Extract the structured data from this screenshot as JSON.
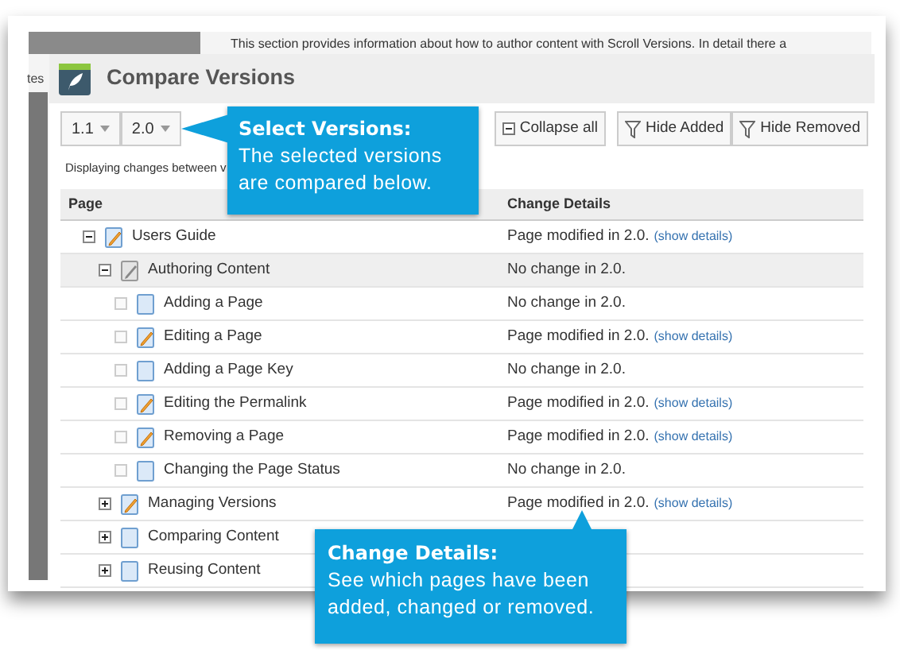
{
  "background_page": {
    "text": "This section provides information about how to author content with Scroll Versions. In detail there a",
    "side_text": "tes"
  },
  "dialog": {
    "title": "Compare Versions"
  },
  "toolbar": {
    "versions": [
      "1.1",
      "2.0"
    ],
    "buttons": [
      {
        "label": "Collapse all",
        "kind": "collapse"
      },
      {
        "label": "Hide Added",
        "kind": "filter"
      },
      {
        "label": "Hide Removed",
        "kind": "filter"
      }
    ]
  },
  "status_text": "Displaying changes between v",
  "table": {
    "columns": [
      "Page",
      "Change Details"
    ],
    "rows": [
      {
        "page": "Users Guide",
        "kind": "modified",
        "expanded": true,
        "selected": false,
        "change": "Page modified in 2.0.",
        "link": "(show details)",
        "children": [
          {
            "page": "Authoring Content",
            "kind": "folder",
            "expanded": true,
            "selected": true,
            "change": "No change in 2.0.",
            "children": [
              {
                "page": "Adding a Page",
                "kind": "plain",
                "selected": false,
                "change": "No change in 2.0."
              },
              {
                "page": "Editing a Page",
                "kind": "modified",
                "selected": false,
                "change": "Page modified in 2.0.",
                "link": "(show details)"
              },
              {
                "page": "Adding a Page Key",
                "kind": "plain",
                "selected": false,
                "change": "No change in 2.0."
              },
              {
                "page": "Editing the Permalink",
                "kind": "modified",
                "selected": false,
                "change": "Page modified in 2.0.",
                "link": "(show details)"
              },
              {
                "page": "Removing a Page",
                "kind": "modified",
                "selected": false,
                "change": "Page modified in 2.0.",
                "link": "(show details)"
              },
              {
                "page": "Changing the Page Status",
                "kind": "plain",
                "selected": false,
                "change": "No change in 2.0."
              }
            ]
          },
          {
            "page": "Managing Versions",
            "kind": "modified",
            "expanded": false,
            "selected": false,
            "change": "Page modified in 2.0.",
            "link": "(show details)"
          },
          {
            "page": "Comparing Content",
            "kind": "plain",
            "expanded": false,
            "selected": false
          },
          {
            "page": "Reusing Content",
            "kind": "plain",
            "expanded": false,
            "selected": false
          }
        ]
      }
    ]
  },
  "callouts": [
    {
      "title": "Select Versions:",
      "text": "The selected versions are compared below."
    },
    {
      "title": "Change Details:",
      "text": "See which pages have been added, changed or removed."
    }
  ]
}
